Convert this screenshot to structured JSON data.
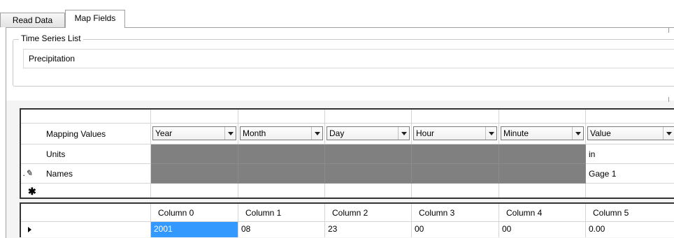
{
  "tabs": [
    {
      "label": "Read Data",
      "active": false
    },
    {
      "label": "Map Fields",
      "active": true
    }
  ],
  "time_series_group": {
    "legend": "Time Series List",
    "value": "Precipitation"
  },
  "mapping_grid": {
    "columns": [
      {
        "mapping": "Year",
        "units": "",
        "names": "",
        "editable": false
      },
      {
        "mapping": "Month",
        "units": "",
        "names": "",
        "editable": false
      },
      {
        "mapping": "Day",
        "units": "",
        "names": "",
        "editable": false
      },
      {
        "mapping": "Hour",
        "units": "",
        "names": "",
        "editable": false
      },
      {
        "mapping": "Minute",
        "units": "",
        "names": "",
        "editable": false
      },
      {
        "mapping": "Value",
        "units": "in",
        "names": "Gage 1",
        "editable": true
      }
    ],
    "row_labels": {
      "mapping": "Mapping Values",
      "units": "Units",
      "names": "Names"
    },
    "icons": {
      "editing_row": "pencil-icon",
      "new_row": "asterisk-icon",
      "dropdown": "chevron-down-icon"
    },
    "disabled_color": "#808080"
  },
  "data_grid": {
    "headers": [
      "Column 0",
      "Column 1",
      "Column 2",
      "Column 3",
      "Column 4",
      "Column 5"
    ],
    "rows": [
      [
        "2001",
        "08",
        "23",
        "00",
        "00",
        "0.00"
      ]
    ],
    "selected_cell_color": "#3399ff"
  }
}
